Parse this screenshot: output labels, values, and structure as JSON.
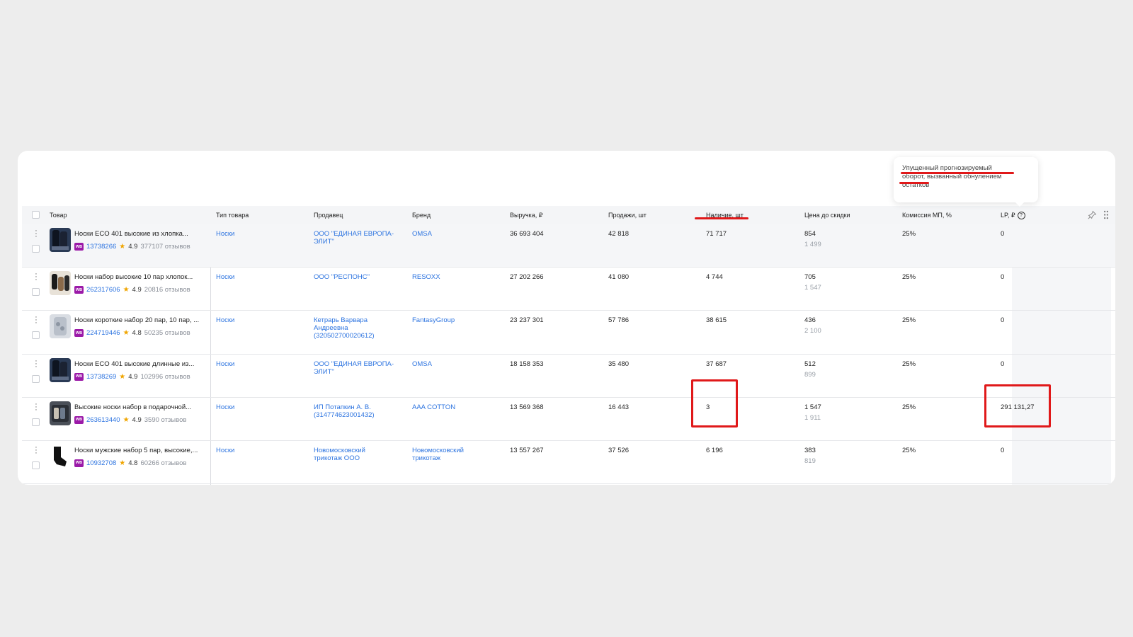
{
  "headers": {
    "product": "Товар",
    "type": "Тип товара",
    "seller": "Продавец",
    "brand": "Бренд",
    "revenue": "Выручка, ₽",
    "sales": "Продажи, шт",
    "stock": "Наличие, шт",
    "price": "Цена до скидки",
    "commission": "Комиссия МП, %",
    "lp": "LP, ₽"
  },
  "tooltip": {
    "line1": "Упущенный прогнозируемый",
    "line2a": "оборот",
    "line2b": ", вызванный обнулением",
    "line3": "остатков"
  },
  "rows": [
    {
      "name": "Носки ECO 401 высокие из хлопка...",
      "badge": "WB",
      "sku": "13738266",
      "rating": "4.9",
      "reviews": "377107 отзывов",
      "type": "Носки",
      "seller": "ООО \"ЕДИНАЯ ЕВРОПА-ЭЛИТ\"",
      "brand": "OMSA",
      "revenue": "36 693 404",
      "sales": "42 818",
      "stock": "71 717",
      "price": "854",
      "price_old": "1 499",
      "commission": "25%",
      "lp": "0"
    },
    {
      "name": "Носки набор высокие 10 пар хлопок...",
      "badge": "WB",
      "sku": "262317606",
      "rating": "4.9",
      "reviews": "20816 отзывов",
      "type": "Носки",
      "seller": "ООО \"РЕСПОНС\"",
      "brand": "RESOXX",
      "revenue": "27 202 266",
      "sales": "41 080",
      "stock": "4 744",
      "price": "705",
      "price_old": "1 547",
      "commission": "25%",
      "lp": "0"
    },
    {
      "name": "Носки короткие набор 20 пар, 10 пар, ...",
      "badge": "WB",
      "sku": "224719446",
      "rating": "4.8",
      "reviews": "50235 отзывов",
      "type": "Носки",
      "seller": "Кетрарь Варвара Андреевна (320502700020612)",
      "brand": "FantasyGroup",
      "revenue": "23 237 301",
      "sales": "57 786",
      "stock": "38 615",
      "price": "436",
      "price_old": "2 100",
      "commission": "25%",
      "lp": "0"
    },
    {
      "name": "Носки ECO 401 высокие длинные из...",
      "badge": "WB",
      "sku": "13738269",
      "rating": "4.9",
      "reviews": "102996 отзывов",
      "type": "Носки",
      "seller": "ООО \"ЕДИНАЯ ЕВРОПА-ЭЛИТ\"",
      "brand": "OMSA",
      "revenue": "18 158 353",
      "sales": "35 480",
      "stock": "37 687",
      "price": "512",
      "price_old": "899",
      "commission": "25%",
      "lp": "0"
    },
    {
      "name": "Высокие носки набор в подарочной...",
      "badge": "WB",
      "sku": "263613440",
      "rating": "4.9",
      "reviews": "3590 отзывов",
      "type": "Носки",
      "seller": "ИП Потапкин А. В. (314774623001432)",
      "brand": "AAA COTTON",
      "revenue": "13 569 368",
      "sales": "16 443",
      "stock": "3",
      "price": "1 547",
      "price_old": "1 911",
      "commission": "25%",
      "lp": "291 131,27"
    },
    {
      "name": "Носки мужские набор 5 пар, высокие,...",
      "badge": "WB",
      "sku": "10932708",
      "rating": "4.8",
      "reviews": "60266 отзывов",
      "type": "Носки",
      "seller": "Новомосковский трикотаж ООО",
      "brand": "Новомосковский трикотаж",
      "revenue": "13 557 267",
      "sales": "37 526",
      "stock": "6 196",
      "price": "383",
      "price_old": "819",
      "commission": "25%",
      "lp": "0"
    }
  ],
  "colors": {
    "accent": "#2d74e0",
    "highlight": "#e0191a",
    "badge": "#9b1aa8"
  },
  "icons": [
    "more-vertical-icon",
    "star-icon",
    "help-circle-icon",
    "pin-icon",
    "drag-grip-icon"
  ]
}
